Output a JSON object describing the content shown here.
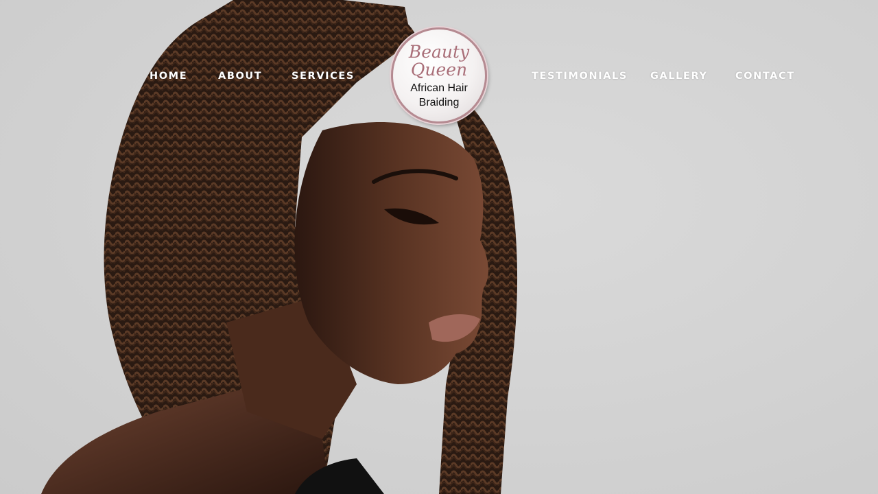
{
  "nav": {
    "home": "HOME",
    "about": "ABOUT",
    "services": "SERVICES",
    "testimonials": "TESTIMONIALS",
    "gallery": "GALLERY",
    "contact": "CONTACT"
  },
  "logo": {
    "line1": "Beauty",
    "line2": "Queen",
    "line3": "African Hair",
    "line4": "Braiding"
  },
  "colors": {
    "background": "#d4d4d4",
    "nav_text": "#ffffff",
    "logo_accent": "#a96e78"
  }
}
